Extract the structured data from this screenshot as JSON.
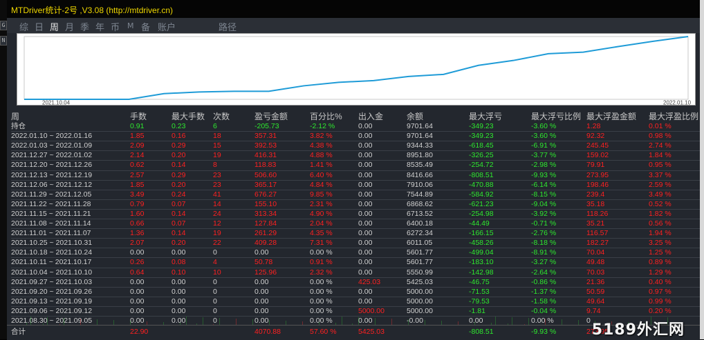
{
  "window": {
    "title": "MTDriver统计-2号 ,V3.08 (http://mtdriver.cn)"
  },
  "left_strip": [
    "G",
    "N"
  ],
  "tabs": [
    {
      "label": "综",
      "active": false
    },
    {
      "label": "日",
      "active": false
    },
    {
      "label": "周",
      "active": true
    },
    {
      "label": "月",
      "active": false
    },
    {
      "label": "季",
      "active": false
    },
    {
      "label": "年",
      "active": false
    },
    {
      "label": "币",
      "active": false
    },
    {
      "label": "M",
      "active": false
    },
    {
      "label": "备",
      "active": false
    },
    {
      "label": "账户",
      "active": false
    },
    {
      "label": "路径",
      "active": false
    }
  ],
  "chart_data": {
    "type": "line",
    "x_start_label": "2021.10.04",
    "x_end_label": "2022.01.10",
    "x": [
      "2021.08.30",
      "2021.09.06",
      "2021.09.13",
      "2021.09.20",
      "2021.09.27",
      "2021.10.04",
      "2021.10.11",
      "2021.10.18",
      "2021.10.25",
      "2021.11.01",
      "2021.11.08",
      "2021.11.15",
      "2021.11.22",
      "2021.11.29",
      "2021.12.06",
      "2021.12.13",
      "2021.12.20",
      "2021.12.27",
      "2022.01.03",
      "2022.01.10"
    ],
    "series": [
      {
        "values": [
          5000.0,
          5000.0,
          5000.0,
          5000.0,
          5425.03,
          5550.99,
          5601.77,
          5601.77,
          6011.05,
          6272.34,
          6400.18,
          6713.52,
          6868.62,
          7544.89,
          7910.06,
          8416.66,
          8535.49,
          8951.8,
          9344.33,
          9701.64
        ]
      }
    ],
    "line_color": "#1e9bd7"
  },
  "table": {
    "headers": [
      "周",
      "手数",
      "最大手数",
      "次数",
      "盈亏金额",
      "百分比%",
      "出入金",
      "余额",
      "最大浮亏",
      "最大浮亏比例",
      "最大浮盈金额",
      "最大浮盈比例"
    ],
    "position": {
      "label": "持仓",
      "lots": "0.91",
      "max_lots": "0.23",
      "count": "6",
      "pl": "-205.73",
      "pct": "-2.12 %",
      "io": "0.00",
      "balance": "9701.64",
      "max_dd": "-349.23",
      "max_dd_pct": "-3.60 %",
      "max_fp": "1.28",
      "max_fp_pct": "0.01 %"
    },
    "rows": [
      {
        "week": "2022.01.10 ~ 2022.01.16",
        "lots": "1.85",
        "max_lots": "0.16",
        "count": "18",
        "pl": "357.31",
        "pct": "3.82 %",
        "io": "0.00",
        "balance": "9701.64",
        "max_dd": "-349.23",
        "max_dd_pct": "-3.60 %",
        "max_fp": "92.32",
        "max_fp_pct": "0.98 %",
        "io_red": false
      },
      {
        "week": "2022.01.03 ~ 2022.01.09",
        "lots": "2.09",
        "max_lots": "0.29",
        "count": "15",
        "pl": "392.53",
        "pct": "4.38 %",
        "io": "0.00",
        "balance": "9344.33",
        "max_dd": "-618.45",
        "max_dd_pct": "-6.91 %",
        "max_fp": "245.45",
        "max_fp_pct": "2.74 %",
        "io_red": false
      },
      {
        "week": "2021.12.27 ~ 2022.01.02",
        "lots": "2.14",
        "max_lots": "0.20",
        "count": "19",
        "pl": "416.31",
        "pct": "4.88 %",
        "io": "0.00",
        "balance": "8951.80",
        "max_dd": "-326.25",
        "max_dd_pct": "-3.77 %",
        "max_fp": "159.02",
        "max_fp_pct": "1.84 %",
        "io_red": false
      },
      {
        "week": "2021.12.20 ~ 2021.12.26",
        "lots": "0.62",
        "max_lots": "0.14",
        "count": "8",
        "pl": "118.83",
        "pct": "1.41 %",
        "io": "0.00",
        "balance": "8535.49",
        "max_dd": "-254.72",
        "max_dd_pct": "-2.98 %",
        "max_fp": "79.91",
        "max_fp_pct": "0.95 %",
        "io_red": false
      },
      {
        "week": "2021.12.13 ~ 2021.12.19",
        "lots": "2.57",
        "max_lots": "0.29",
        "count": "23",
        "pl": "506.60",
        "pct": "6.40 %",
        "io": "0.00",
        "balance": "8416.66",
        "max_dd": "-808.51",
        "max_dd_pct": "-9.93 %",
        "max_fp": "273.95",
        "max_fp_pct": "3.37 %",
        "io_red": false
      },
      {
        "week": "2021.12.06 ~ 2021.12.12",
        "lots": "1.85",
        "max_lots": "0.20",
        "count": "23",
        "pl": "365.17",
        "pct": "4.84 %",
        "io": "0.00",
        "balance": "7910.06",
        "max_dd": "-470.88",
        "max_dd_pct": "-6.14 %",
        "max_fp": "198.46",
        "max_fp_pct": "2.59 %",
        "io_red": false
      },
      {
        "week": "2021.11.29 ~ 2021.12.05",
        "lots": "3.49",
        "max_lots": "0.24",
        "count": "41",
        "pl": "676.27",
        "pct": "9.85 %",
        "io": "0.00",
        "balance": "7544.89",
        "max_dd": "-584.92",
        "max_dd_pct": "-8.15 %",
        "max_fp": "239.4",
        "max_fp_pct": "3.49 %",
        "io_red": false
      },
      {
        "week": "2021.11.22 ~ 2021.11.28",
        "lots": "0.79",
        "max_lots": "0.07",
        "count": "14",
        "pl": "155.10",
        "pct": "2.31 %",
        "io": "0.00",
        "balance": "6868.62",
        "max_dd": "-621.23",
        "max_dd_pct": "-9.04 %",
        "max_fp": "35.18",
        "max_fp_pct": "0.52 %",
        "io_red": false
      },
      {
        "week": "2021.11.15 ~ 2021.11.21",
        "lots": "1.60",
        "max_lots": "0.14",
        "count": "24",
        "pl": "313.34",
        "pct": "4.90 %",
        "io": "0.00",
        "balance": "6713.52",
        "max_dd": "-254.98",
        "max_dd_pct": "-3.92 %",
        "max_fp": "118.26",
        "max_fp_pct": "1.82 %",
        "io_red": false
      },
      {
        "week": "2021.11.08 ~ 2021.11.14",
        "lots": "0.66",
        "max_lots": "0.07",
        "count": "12",
        "pl": "127.84",
        "pct": "2.04 %",
        "io": "0.00",
        "balance": "6400.18",
        "max_dd": "-44.49",
        "max_dd_pct": "-0.71 %",
        "max_fp": "35.21",
        "max_fp_pct": "0.56 %",
        "io_red": false
      },
      {
        "week": "2021.11.01 ~ 2021.11.07",
        "lots": "1.36",
        "max_lots": "0.14",
        "count": "19",
        "pl": "261.29",
        "pct": "4.35 %",
        "io": "0.00",
        "balance": "6272.34",
        "max_dd": "-166.15",
        "max_dd_pct": "-2.76 %",
        "max_fp": "116.57",
        "max_fp_pct": "1.94 %",
        "io_red": false
      },
      {
        "week": "2021.10.25 ~ 2021.10.31",
        "lots": "2.07",
        "max_lots": "0.20",
        "count": "22",
        "pl": "409.28",
        "pct": "7.31 %",
        "io": "0.00",
        "balance": "6011.05",
        "max_dd": "-458.26",
        "max_dd_pct": "-8.18 %",
        "max_fp": "182.27",
        "max_fp_pct": "3.25 %",
        "io_red": false
      },
      {
        "week": "2021.10.18 ~ 2021.10.24",
        "lots": "0.00",
        "max_lots": "0.00",
        "count": "0",
        "pl": "0.00",
        "pct": "0.00 %",
        "io": "0.00",
        "balance": "5601.77",
        "max_dd": "-499.04",
        "max_dd_pct": "-8.91 %",
        "max_fp": "70.04",
        "max_fp_pct": "1.25 %",
        "io_red": false
      },
      {
        "week": "2021.10.11 ~ 2021.10.17",
        "lots": "0.26",
        "max_lots": "0.08",
        "count": "4",
        "pl": "50.78",
        "pct": "0.91 %",
        "io": "0.00",
        "balance": "5601.77",
        "max_dd": "-183.10",
        "max_dd_pct": "-3.27 %",
        "max_fp": "49.48",
        "max_fp_pct": "0.89 %",
        "io_red": false
      },
      {
        "week": "2021.10.04 ~ 2021.10.10",
        "lots": "0.64",
        "max_lots": "0.10",
        "count": "10",
        "pl": "125.96",
        "pct": "2.32 %",
        "io": "0.00",
        "balance": "5550.99",
        "max_dd": "-142.98",
        "max_dd_pct": "-2.64 %",
        "max_fp": "70.03",
        "max_fp_pct": "1.29 %",
        "io_red": false
      },
      {
        "week": "2021.09.27 ~ 2021.10.03",
        "lots": "0.00",
        "max_lots": "0.00",
        "count": "0",
        "pl": "0.00",
        "pct": "0.00 %",
        "io": "425.03",
        "balance": "5425.03",
        "max_dd": "-46.75",
        "max_dd_pct": "-0.86 %",
        "max_fp": "21.36",
        "max_fp_pct": "0.40 %",
        "io_red": true
      },
      {
        "week": "2021.09.20 ~ 2021.09.26",
        "lots": "0.00",
        "max_lots": "0.00",
        "count": "0",
        "pl": "0.00",
        "pct": "0.00 %",
        "io": "0.00",
        "balance": "5000.00",
        "max_dd": "-71.53",
        "max_dd_pct": "-1.37 %",
        "max_fp": "50.59",
        "max_fp_pct": "0.97 %",
        "io_red": false
      },
      {
        "week": "2021.09.13 ~ 2021.09.19",
        "lots": "0.00",
        "max_lots": "0.00",
        "count": "0",
        "pl": "0.00",
        "pct": "0.00 %",
        "io": "0.00",
        "balance": "5000.00",
        "max_dd": "-79.53",
        "max_dd_pct": "-1.58 %",
        "max_fp": "49.64",
        "max_fp_pct": "0.99 %",
        "io_red": false
      },
      {
        "week": "2021.09.06 ~ 2021.09.12",
        "lots": "0.00",
        "max_lots": "0.00",
        "count": "0",
        "pl": "0.00",
        "pct": "0.00 %",
        "io": "5000.00",
        "balance": "5000.00",
        "max_dd": "-1.81",
        "max_dd_pct": "-0.04 %",
        "max_fp": "9.74",
        "max_fp_pct": "0.20 %",
        "io_red": true
      },
      {
        "week": "2021.08.30 ~ 2021.09.05",
        "lots": "0.00",
        "max_lots": "0.00",
        "count": "0",
        "pl": "0.00",
        "pct": "0.00 %",
        "io": "0.00",
        "balance": "-0.00",
        "max_dd": "0.00",
        "max_dd_pct": "0.00 %",
        "max_fp": "0",
        "max_fp_pct": "",
        "io_red": false
      }
    ],
    "total": {
      "label": "合计",
      "lots": "22.90",
      "pl": "4070.88",
      "pct": "57.60 %",
      "io": "5425.03",
      "max_dd": "-808.51",
      "max_dd_pct": "-9.93 %",
      "max_fp": "273.95"
    }
  },
  "watermark": "5189外汇网",
  "colors": {
    "positive": "#ff2020",
    "negative": "#2ee82e",
    "neutral": "#d0d0d0",
    "title": "#f0d800",
    "line": "#1e9bd7"
  }
}
